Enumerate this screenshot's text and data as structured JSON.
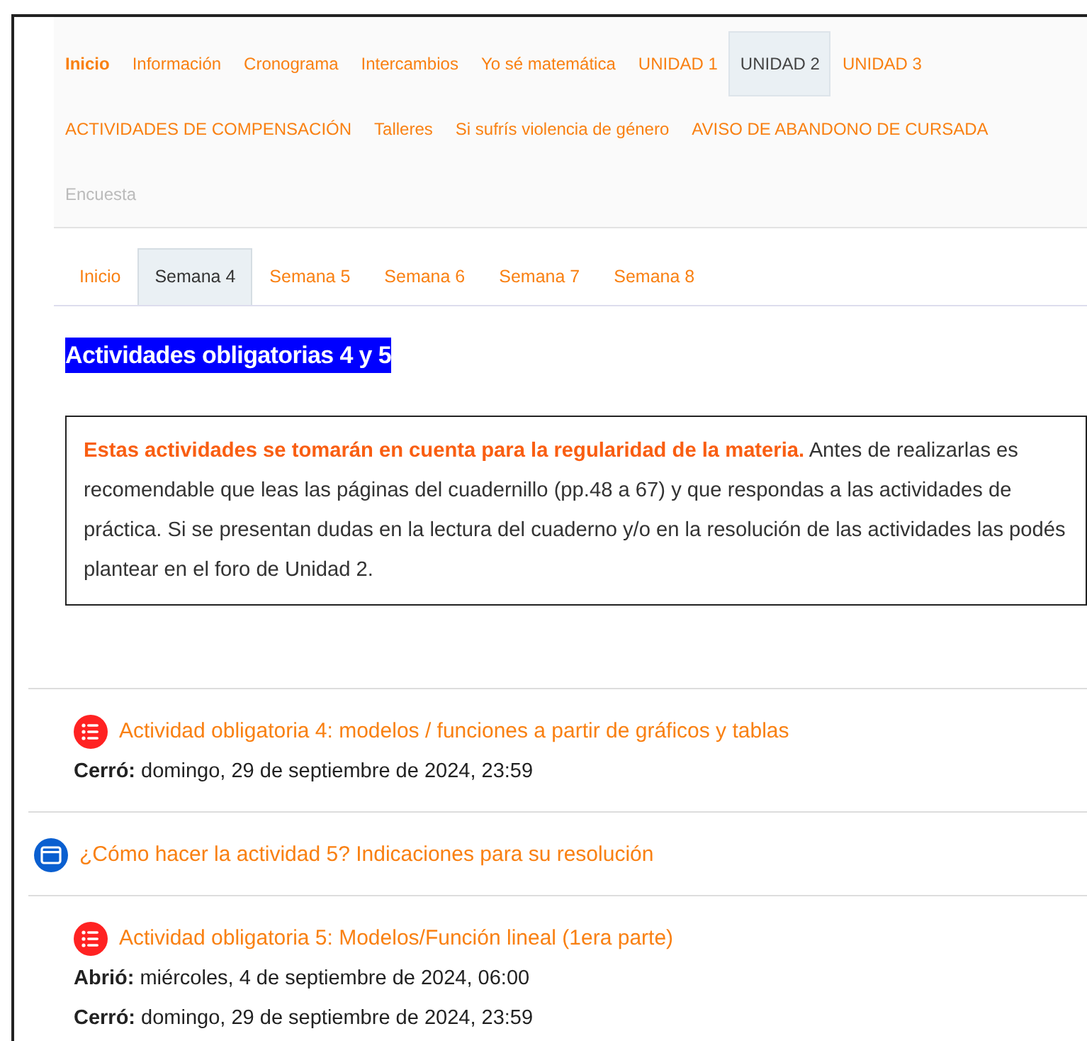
{
  "course_nav": [
    {
      "label": "Inicio",
      "selected": false,
      "current": true,
      "disabled": false
    },
    {
      "label": "Información",
      "selected": false,
      "current": false,
      "disabled": false
    },
    {
      "label": "Cronograma",
      "selected": false,
      "current": false,
      "disabled": false
    },
    {
      "label": "Intercambios",
      "selected": false,
      "current": false,
      "disabled": false
    },
    {
      "label": "Yo sé matemática",
      "selected": false,
      "current": false,
      "disabled": false
    },
    {
      "label": "UNIDAD 1",
      "selected": false,
      "current": false,
      "disabled": false
    },
    {
      "label": "UNIDAD 2",
      "selected": true,
      "current": false,
      "disabled": false
    },
    {
      "label": "UNIDAD 3",
      "selected": false,
      "current": false,
      "disabled": false
    },
    {
      "label": "ACTIVIDADES DE COMPENSACIÓN",
      "selected": false,
      "current": false,
      "disabled": false
    },
    {
      "label": "Talleres",
      "selected": false,
      "current": false,
      "disabled": false
    },
    {
      "label": "Si sufrís violencia de género",
      "selected": false,
      "current": false,
      "disabled": false
    },
    {
      "label": "AVISO DE ABANDONO DE CURSADA",
      "selected": false,
      "current": false,
      "disabled": false
    },
    {
      "label": "Encuesta",
      "selected": false,
      "current": false,
      "disabled": true
    }
  ],
  "week_tabs": [
    {
      "label": "Inicio",
      "selected": false
    },
    {
      "label": "Semana 4",
      "selected": true
    },
    {
      "label": "Semana 5",
      "selected": false
    },
    {
      "label": "Semana 6",
      "selected": false
    },
    {
      "label": "Semana 7",
      "selected": false
    },
    {
      "label": "Semana 8",
      "selected": false
    }
  ],
  "section_title": "Actividades obligatorias 4 y 5",
  "notice": {
    "highlight": "Estas actividades se tomarán en cuenta para la regularidad de la materia.",
    "text": "Antes de realizarlas es recomendable que leas las páginas del cuadernillo (pp.48 a 67) y que respondas a las actividades de práctica. Si se presentan dudas en la lectura del cuaderno y/o en la resolución de las actividades las podés plantear en el foro de Unidad 2."
  },
  "activities": [
    {
      "kind": "assignment",
      "title": "Actividad obligatoria 4: modelos / funciones a partir de gráficos y tablas",
      "dates": [
        "**Cerró:** domingo, 29 de septiembre de 2024, 23:59"
      ]
    },
    {
      "kind": "page",
      "title": "¿Cómo hacer la actividad 5? Indicaciones para su resolución"
    },
    {
      "kind": "assignment",
      "title": "Actividad obligatoria 5: Modelos/Función lineal (1era parte)",
      "dates": [
        "**Abrió:** miércoles, 4 de septiembre de 2024, 06:00",
        "**Cerró:** domingo, 29 de septiembre de 2024, 23:59"
      ]
    }
  ]
}
